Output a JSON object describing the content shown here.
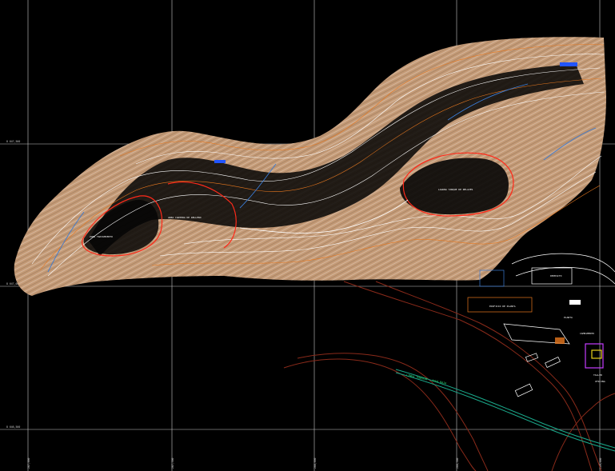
{
  "colors": {
    "background": "#000000",
    "grid": "#c8c8c8",
    "terrain": "#c49a76",
    "contour_light": "#ffffff",
    "contour_orange": "#e8781e",
    "drainage": "#3a7bd5",
    "boundary": "#ff2a1a",
    "road": "#8a2a1a",
    "pipeline": "#1aa88a",
    "label_green": "#2fe07a",
    "accent_magenta": "#c43cff",
    "accent_yellow": "#e8d21a"
  },
  "map": {
    "area_labels": [
      "ZONA TRATAMIENTO",
      "AREA CANTERA DE RELLENO",
      "LAGUNA TANQUE DE RELAVES",
      "DEPOSITO"
    ],
    "structure_labels": [
      "EDIFICIO DE PLANTA",
      "PLANTA",
      "CAMPAMENTO",
      "TALLER",
      "OFICINA"
    ],
    "route_label": "LINEA TUBERIA - AGUA BAJA",
    "grid_y_labels": [
      "8 647,500",
      "8 647,000",
      "8 646,500"
    ],
    "grid_x_labels": [
      "287,000",
      "287,500",
      "288,000",
      "288,500",
      "289,000"
    ]
  }
}
